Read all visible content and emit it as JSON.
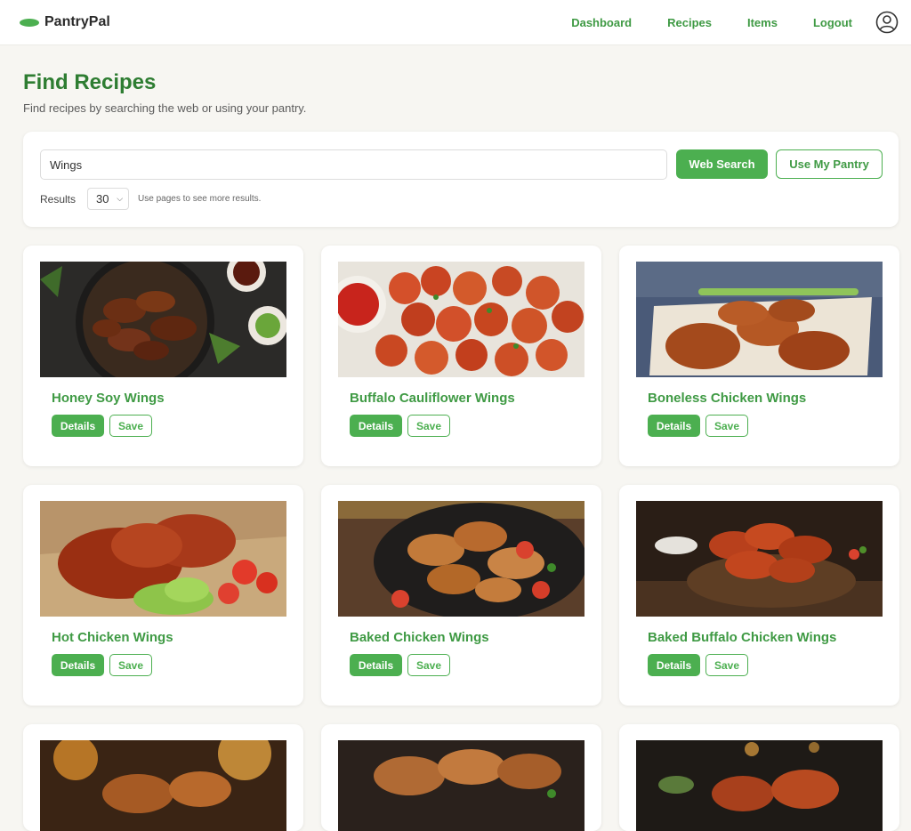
{
  "app": {
    "name": "PantryPal",
    "accent": "#4caf50",
    "title_color": "#2e7d32"
  },
  "nav": {
    "links": [
      "Dashboard",
      "Recipes",
      "Items",
      "Logout"
    ],
    "profile_icon": "user-circle-icon"
  },
  "header": {
    "title": "Find Recipes",
    "subtitle": "Find recipes by searching the web or using your pantry."
  },
  "search": {
    "query": "Wings",
    "web_search_label": "Web Search",
    "use_pantry_label": "Use My Pantry",
    "results_label": "Results",
    "results_count": "30",
    "results_hint": "Use pages to see more results."
  },
  "recipes": [
    {
      "title": "Honey Soy Wings",
      "details": "Details",
      "save": "Save"
    },
    {
      "title": "Buffalo Cauliflower Wings",
      "details": "Details",
      "save": "Save"
    },
    {
      "title": "Boneless Chicken Wings",
      "details": "Details",
      "save": "Save"
    },
    {
      "title": "Hot Chicken Wings",
      "details": "Details",
      "save": "Save"
    },
    {
      "title": "Baked Chicken Wings",
      "details": "Details",
      "save": "Save"
    },
    {
      "title": "Baked Buffalo Chicken Wings",
      "details": "Details",
      "save": "Save"
    },
    {
      "title": "",
      "details": "",
      "save": ""
    },
    {
      "title": "",
      "details": "",
      "save": ""
    },
    {
      "title": "",
      "details": "",
      "save": ""
    }
  ]
}
